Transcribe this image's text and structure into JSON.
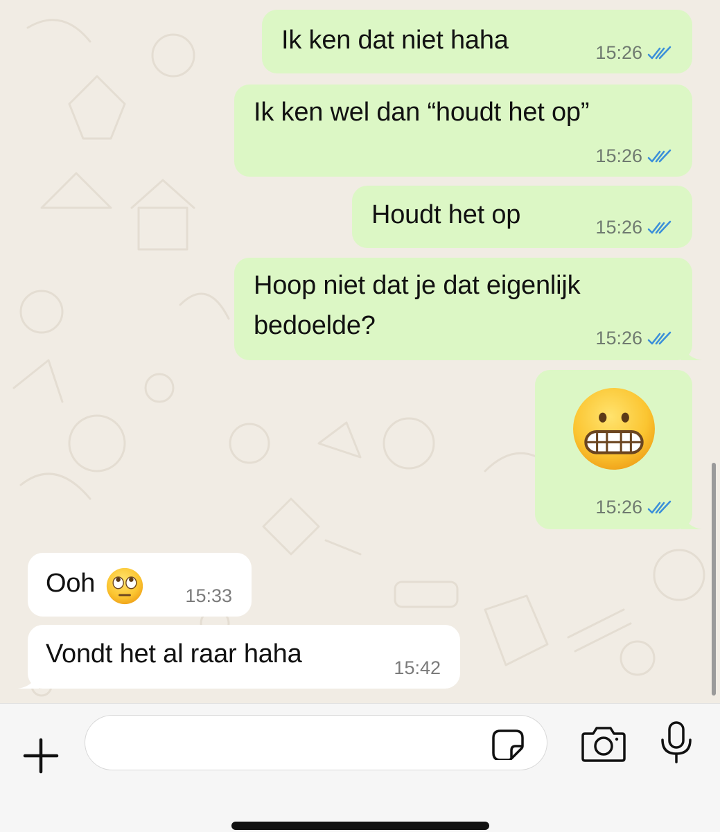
{
  "messages": [
    {
      "direction": "outgoing",
      "text": "Ik ken dat niet haha",
      "time": "15:26",
      "status": "read"
    },
    {
      "direction": "outgoing",
      "text": "Ik ken wel dan “houdt het op”",
      "time": "15:26",
      "status": "read"
    },
    {
      "direction": "outgoing",
      "text": "Houdt het op",
      "time": "15:26",
      "status": "read"
    },
    {
      "direction": "outgoing",
      "text_line1": "Hoop niet dat je dat eigenlijk",
      "text_line2": "bedoelde?",
      "time": "15:26",
      "status": "read"
    },
    {
      "direction": "outgoing",
      "emoji": "grimacing-face",
      "time": "15:26",
      "status": "read"
    },
    {
      "direction": "incoming",
      "text": "Ooh",
      "emoji": "face-with-rolling-eyes",
      "time": "15:33"
    },
    {
      "direction": "incoming",
      "text": "Vondt het al raar haha",
      "time": "15:42"
    }
  ],
  "composer": {
    "placeholder": "",
    "icons": [
      "plus-icon",
      "sticker-icon",
      "camera-icon",
      "microphone-icon"
    ]
  },
  "colors": {
    "outgoing_bubble": "#dcf7c5",
    "incoming_bubble": "#ffffff",
    "read_ticks": "#3b8fd9",
    "chat_background": "#f1ece4"
  }
}
